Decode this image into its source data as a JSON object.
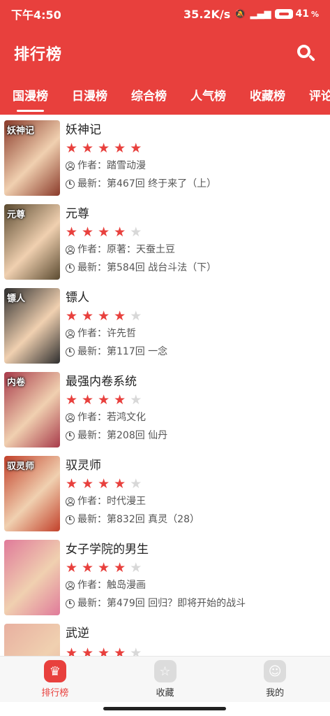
{
  "status_bar": {
    "time": "下午4:50",
    "net_speed": "35.2K/s",
    "battery": "41"
  },
  "app_bar": {
    "title": "排行榜",
    "search_icon": "search-icon"
  },
  "tabs": [
    {
      "label": "国漫榜",
      "active": true
    },
    {
      "label": "日漫榜",
      "active": false
    },
    {
      "label": "综合榜",
      "active": false
    },
    {
      "label": "人气榜",
      "active": false
    },
    {
      "label": "收藏榜",
      "active": false
    },
    {
      "label": "评论榜",
      "active": false
    }
  ],
  "labels": {
    "author_prefix": "作者：",
    "latest_prefix": "最新："
  },
  "comics": [
    {
      "title": "妖神记",
      "rating": 5,
      "author": "踏雪动漫",
      "latest": "第467回 终于来了（上）",
      "cover_text": "妖神记",
      "cover_color": "#8a3a2a"
    },
    {
      "title": "元尊",
      "rating": 4,
      "author": "原著：天蚕土豆",
      "latest": "第584回 战台斗法（下）",
      "cover_text": "元尊",
      "cover_color": "#5a4a30"
    },
    {
      "title": "镖人",
      "rating": 4,
      "author": "许先哲",
      "latest": "第117回 一念",
      "cover_text": "镖人",
      "cover_color": "#2e2e2e"
    },
    {
      "title": "最强内卷系统",
      "rating": 4,
      "author": "若鸿文化",
      "latest": "第208回 仙丹",
      "cover_text": "内卷",
      "cover_color": "#a83a4a"
    },
    {
      "title": "驭灵师",
      "rating": 4,
      "author": "时代漫王",
      "latest": "第832回 真灵（28）",
      "cover_text": "驭灵师",
      "cover_color": "#c2402a"
    },
    {
      "title": "女子学院的男生",
      "rating": 4,
      "author": "触岛漫画",
      "latest": "第479回 回归？即将开始的战斗",
      "cover_text": "",
      "cover_color": "#e07a9a"
    },
    {
      "title": "武逆",
      "rating": 4,
      "author": "",
      "latest": "",
      "cover_text": "",
      "cover_color": "#e8b0a0"
    }
  ],
  "bottom_nav": [
    {
      "label": "排行榜",
      "icon": "ranking-icon",
      "active": true
    },
    {
      "label": "收藏",
      "icon": "star-icon",
      "active": false
    },
    {
      "label": "我的",
      "icon": "profile-icon",
      "active": false
    }
  ],
  "colors": {
    "accent": "#e8403d",
    "star_off": "#d8d8d8"
  }
}
